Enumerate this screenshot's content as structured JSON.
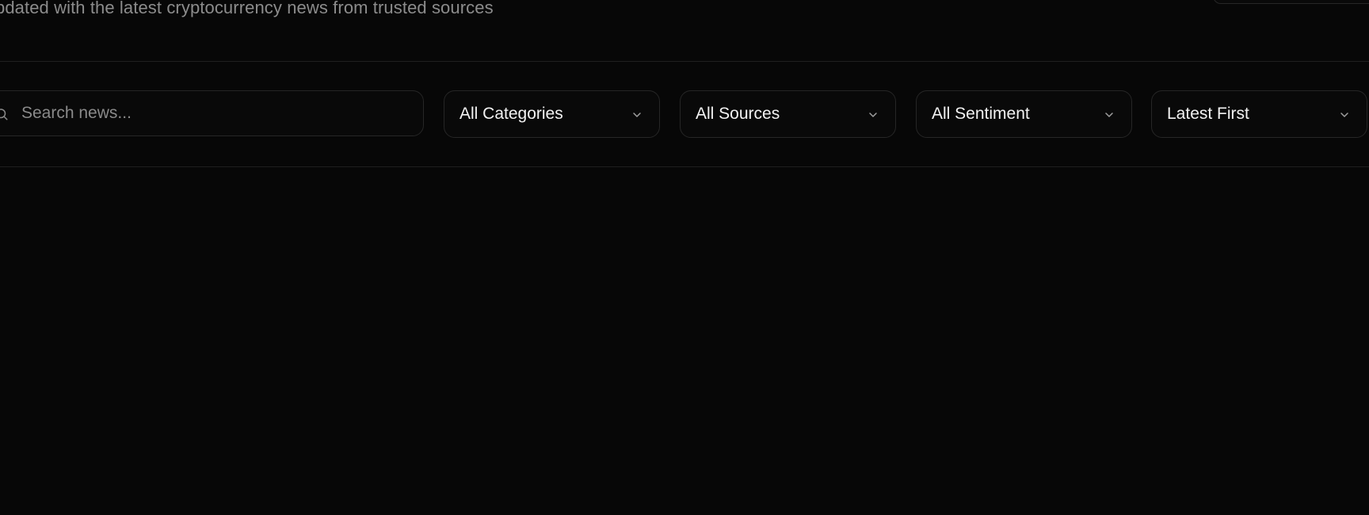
{
  "header": {
    "subtitle": "pdated with the latest cryptocurrency news from trusted sources"
  },
  "filters": {
    "search": {
      "placeholder": "Search news...",
      "value": "",
      "icon": "search-icon"
    },
    "category": {
      "selected": "All Categories",
      "icon": "chevron-down-icon"
    },
    "source": {
      "selected": "All Sources",
      "icon": "chevron-down-icon"
    },
    "sentiment": {
      "selected": "All Sentiment",
      "icon": "chevron-down-icon"
    },
    "sort": {
      "selected": "Latest First",
      "icon": "chevron-down-icon"
    }
  },
  "colors": {
    "background": "#070707",
    "border": "#262626",
    "text": "#f2f2f2",
    "muted_text": "#8c8c8c"
  }
}
